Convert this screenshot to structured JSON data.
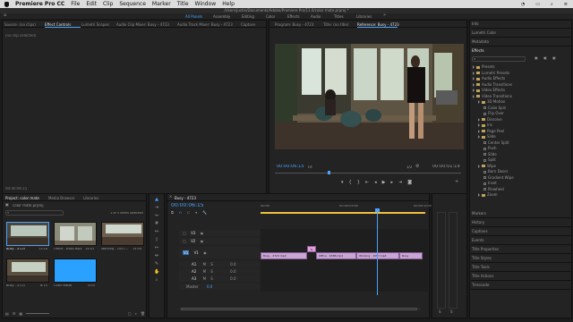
{
  "menubar": {
    "app": "Premiere Pro CC",
    "items": [
      "File",
      "Edit",
      "Clip",
      "Sequence",
      "Marker",
      "Title",
      "Window",
      "Help"
    ]
  },
  "window_title": "/Users/justin/Documents/Adobe/Premiere Pro/11.0/color mate.prproj *",
  "workspaces": {
    "items": [
      "All Panels",
      "Assembly",
      "Editing",
      "Color",
      "Effects",
      "Audio",
      "Titles",
      "Libraries"
    ],
    "active": "All Panels"
  },
  "source_panel": {
    "tabs": [
      "Source: (no clips)",
      "Effect Controls",
      "Lumetri Scopes",
      "Audio Clip Mixer: Busy - 4723",
      "Audio Track Mixer: Busy - 4723"
    ],
    "active_tab": "Effect Controls",
    "no_clip": "(no clip selected)",
    "timecode": "00:00:06:15"
  },
  "program_panel": {
    "tabs": [
      "Capture",
      "Program: Busy - 4723",
      "Title: (no title)",
      "Reference: Busy - 4723"
    ],
    "active_tab": "Reference: Busy - 4723",
    "timecode": "00:00:06:15",
    "fit": "Fit",
    "scale": "1/2",
    "duration": "00:00:01:19"
  },
  "project_panel": {
    "tabs": [
      "Project: color mate",
      "Media Browser",
      "Libraries"
    ],
    "active_tab": "Project: color mate",
    "file": "color mate.prproj",
    "search_icon": "search-icon",
    "selection_info": "1 of 5 items selected",
    "items": [
      {
        "name": "Busy - 4723",
        "duration": "13:18"
      },
      {
        "name": "Office - 6388.mp4",
        "duration": "14:03"
      },
      {
        "name": "Working - 1057...",
        "duration": "14:09"
      },
      {
        "name": "Busy - 4723",
        "duration": "6:15"
      },
      {
        "name": "Color Matte",
        "duration": "5:00"
      }
    ]
  },
  "timeline": {
    "tab": "Busy - 4723",
    "timecode": "00:00:06:15",
    "ruler": [
      "00:00",
      "00:00:05:00",
      "00:00:10:00"
    ],
    "video_tracks": [
      "V3",
      "V2",
      "V1"
    ],
    "audio_tracks": [
      "A1",
      "A2",
      "A3"
    ],
    "master": "Master",
    "master_value": "0.0",
    "track_value": "0.0",
    "clips": [
      {
        "label": "Busy - 4723.mp4"
      },
      {
        "label": "fx"
      },
      {
        "label": "Office - 6388.mp4"
      },
      {
        "label": "Working - 1057.mp4"
      },
      {
        "label": "Busy"
      }
    ]
  },
  "right_panel": {
    "top_items": [
      "Info",
      "Lumetri Color",
      "Metadata"
    ],
    "effects_title": "Effects",
    "tree": [
      {
        "label": "Presets",
        "depth": 0
      },
      {
        "label": "Lumetri Presets",
        "depth": 0
      },
      {
        "label": "Audio Effects",
        "depth": 0
      },
      {
        "label": "Audio Transitions",
        "depth": 0
      },
      {
        "label": "Video Effects",
        "depth": 0
      },
      {
        "label": "Video Transitions",
        "depth": 0
      },
      {
        "label": "3D Motion",
        "depth": 1
      },
      {
        "label": "Cube Spin",
        "depth": 2
      },
      {
        "label": "Flip Over",
        "depth": 2
      },
      {
        "label": "Dissolve",
        "depth": 1
      },
      {
        "label": "Iris",
        "depth": 1
      },
      {
        "label": "Page Peel",
        "depth": 1
      },
      {
        "label": "Slide",
        "depth": 1
      },
      {
        "label": "Center Split",
        "depth": 2
      },
      {
        "label": "Push",
        "depth": 2
      },
      {
        "label": "Slide",
        "depth": 2
      },
      {
        "label": "Split",
        "depth": 2
      },
      {
        "label": "Wipe",
        "depth": 1
      },
      {
        "label": "Barn Doors",
        "depth": 2
      },
      {
        "label": "Gradient Wipe",
        "depth": 2
      },
      {
        "label": "Inset",
        "depth": 2
      },
      {
        "label": "Pinwheel",
        "depth": 2
      },
      {
        "label": "Zoom",
        "depth": 1
      }
    ],
    "bottom_items": [
      "Markers",
      "History",
      "Captions",
      "Events",
      "Title Properties",
      "Title Styles",
      "Title Tools",
      "Title Actions",
      "Timecode"
    ]
  },
  "colors": {
    "accent": "#4aa3ff",
    "clip": "#c8a6d3",
    "playhead": "#4aa3ff",
    "marker": "#e060a8"
  }
}
